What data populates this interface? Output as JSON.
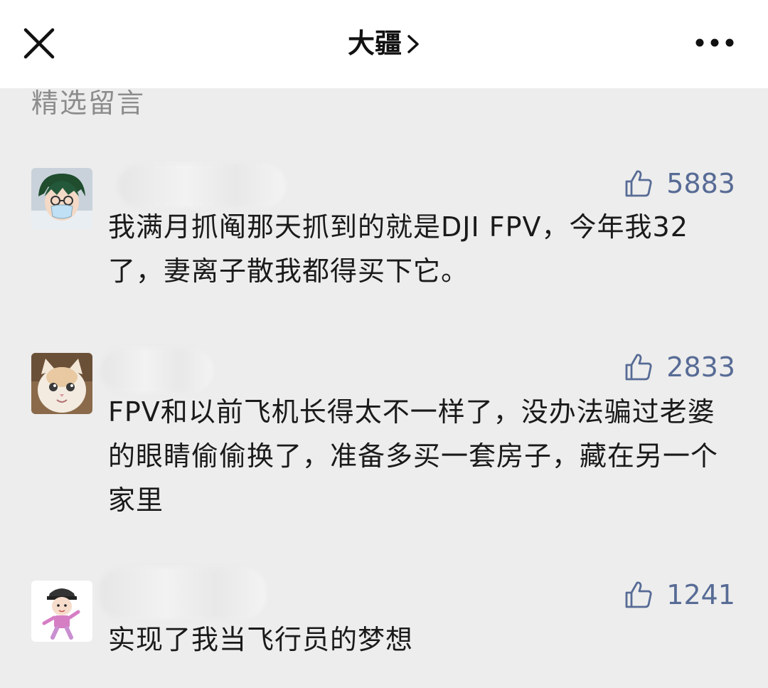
{
  "header": {
    "title": "大疆",
    "chevron_icon": "chevron-right-icon",
    "close_icon": "close-icon",
    "more_icon": "more-dots-icon"
  },
  "section": {
    "label": "精选留言"
  },
  "comments": [
    {
      "likes": "5883",
      "text": "我满月抓阄那天抓到的就是DJI FPV，今年我32了，妻离子散我都得买下它。",
      "avatar": "anime-boy-with-mask"
    },
    {
      "likes": "2833",
      "text": "FPV和以前飞机长得太不一样了，没办法骗过老婆的眼睛偷偷换了，准备多买一套房子，藏在另一个家里",
      "avatar": "cat-photo"
    },
    {
      "likes": "1241",
      "text": "实现了我当飞行员的梦想",
      "avatar": "cartoon-kid-with-cap"
    }
  ],
  "colors": {
    "background": "#ededed",
    "topbar": "#ffffff",
    "like_accent": "#576b95",
    "section_label": "#8c8c8c",
    "text": "#1a1a1a"
  }
}
